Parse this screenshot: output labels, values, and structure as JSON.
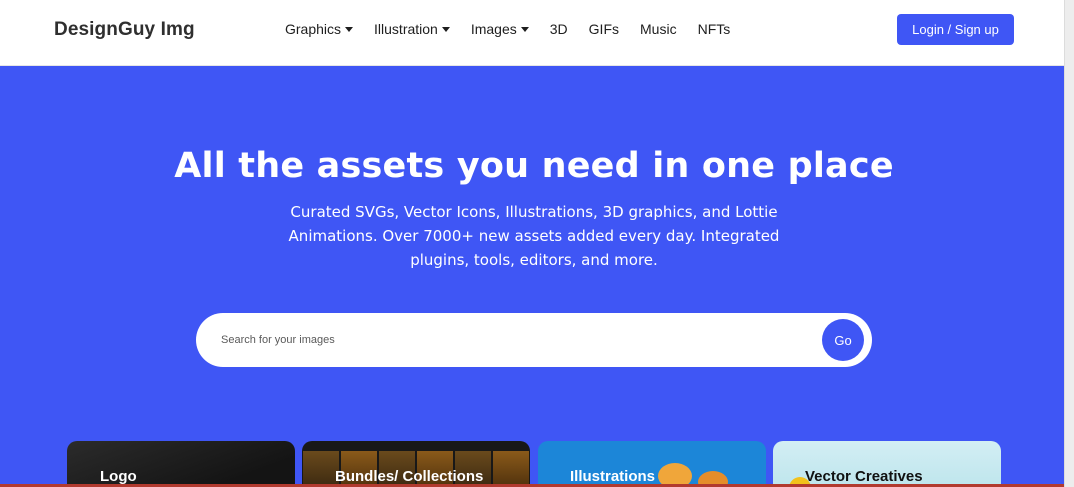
{
  "header": {
    "logo": "DesignGuy Img",
    "nav": [
      {
        "label": "Graphics",
        "dropdown": true
      },
      {
        "label": "Illustration",
        "dropdown": true
      },
      {
        "label": "Images",
        "dropdown": true
      },
      {
        "label": "3D",
        "dropdown": false
      },
      {
        "label": "GIFs",
        "dropdown": false
      },
      {
        "label": "Music",
        "dropdown": false
      },
      {
        "label": "NFTs",
        "dropdown": false
      }
    ],
    "login_label": "Login / Sign up"
  },
  "hero": {
    "title": "All the assets you need in one place",
    "subtitle": "Curated SVGs, Vector Icons, Illustrations, 3D graphics, and Lottie Animations. Over 7000+ new assets added every day. Integrated plugins, tools, editors, and more."
  },
  "search": {
    "placeholder": "Search for your images",
    "value": "",
    "button_label": "Go"
  },
  "categories": [
    {
      "label": "Logo"
    },
    {
      "label": "Bundles/ Collections"
    },
    {
      "label": "Illustrations"
    },
    {
      "label": "Vector Creatives"
    }
  ],
  "colors": {
    "accent": "#3f56f5",
    "header_bg": "#ffffff"
  }
}
